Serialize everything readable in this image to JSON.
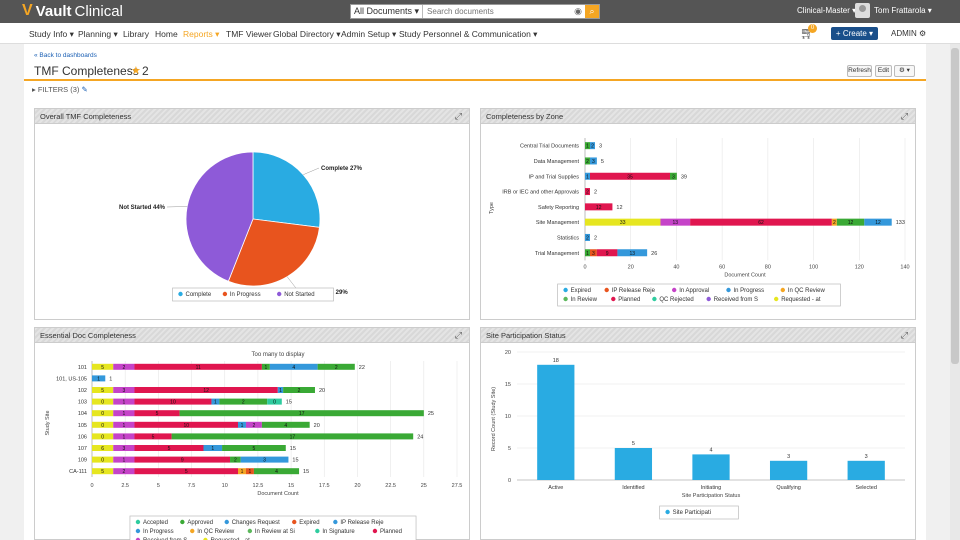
{
  "topbar": {
    "logo_text": "Vault",
    "logo_product": "Clinical",
    "search_scope": "All Documents ▾",
    "search_placeholder": "Search documents",
    "vault_name": "Clinical-Master ▾",
    "user_name": "Tom Frattarola ▾"
  },
  "nav": {
    "items": [
      {
        "label": "Study Info ▾"
      },
      {
        "label": "Planning ▾"
      },
      {
        "label": "Library"
      },
      {
        "label": "Home"
      },
      {
        "label": "Reports ▾"
      },
      {
        "label": "TMF Viewer"
      },
      {
        "label": "Global Directory ▾"
      },
      {
        "label": "Admin Setup ▾"
      },
      {
        "label": "Study Personnel & Communication ▾"
      }
    ],
    "cart_count": "0",
    "create_label": "+ Create ▾",
    "admin_label": "ADMIN ⚙"
  },
  "page": {
    "back_link": "« Back to dashboards",
    "title": "TMF Completeness 2",
    "refresh_label": "Refresh",
    "edit_label": "Edit",
    "settings_label": "⚙ ▾",
    "filters_label": "FILTERS (3)"
  },
  "colors": {
    "accent": "#f5a623",
    "brand_blue": "#1a4f8a",
    "expired": "#29abe2",
    "ip_release": "#e8541e",
    "in_approval": "#c543c8",
    "in_progress": "#3498db",
    "in_qc_review": "#f5a623",
    "in_review": "#5cb85c",
    "planned": "#e0164f",
    "qc_rejected": "#2ecc9f",
    "received": "#8e5ad8",
    "requested": "#e6e620",
    "approved": "#3aa935"
  },
  "panels": {
    "overall": "Overall TMF Completeness",
    "zone": "Completeness by Zone",
    "essential": "Essential Doc Completeness",
    "site": "Site Participation Status"
  },
  "chart_data": [
    {
      "type": "pie",
      "title": "",
      "slices": [
        {
          "name": "Complete",
          "value": 27,
          "label": "Complete 27%",
          "color": "#29abe2"
        },
        {
          "name": "In Progress",
          "value": 29,
          "label": "In Progress 29%",
          "color": "#e8541e"
        },
        {
          "name": "Not Started",
          "value": 44,
          "label": "Not Started 44%",
          "color": "#8e5ad8"
        }
      ],
      "legend": [
        "Complete",
        "In Progress",
        "Not Started"
      ],
      "legend_position": "bottom"
    },
    {
      "type": "bar",
      "orientation": "horizontal",
      "stacked": true,
      "ylabel": "Type",
      "xlabel": "Document Count",
      "xlim": [
        0,
        140
      ],
      "xticks": [
        "0",
        "20",
        "40",
        "60",
        "80",
        "100",
        "120",
        "140"
      ],
      "grid": true,
      "categories": [
        "Central Trial Documents",
        "Data Management",
        "IP and Trial Supplies",
        "IRB or IEC and other Approvals",
        "Safety Reporting",
        "Site Management",
        "Statistics",
        "Trial Management"
      ],
      "totals": [
        3,
        5,
        39,
        2,
        12,
        133,
        2,
        26
      ],
      "series": [
        {
          "name": "Expired",
          "color": "#29abe2",
          "values": [
            0,
            0,
            0,
            0,
            0,
            0,
            0,
            0
          ]
        },
        {
          "name": "IP Release Reje",
          "color": "#e8541e",
          "values": [
            0,
            0,
            0,
            0,
            0,
            0,
            0,
            3
          ]
        },
        {
          "name": "In Approval",
          "color": "#c543c8",
          "values": [
            0,
            0,
            0,
            0,
            0,
            0,
            0,
            0
          ]
        },
        {
          "name": "In Progress",
          "color": "#3498db",
          "values": [
            2,
            3,
            0,
            0,
            0,
            0,
            2,
            13
          ]
        },
        {
          "name": "In QC Review",
          "color": "#f5a623",
          "values": [
            0,
            0,
            0,
            0,
            0,
            0,
            0,
            0
          ]
        },
        {
          "name": "In Review",
          "color": "#5cb85c",
          "values": [
            0,
            0,
            0,
            0,
            0,
            0,
            0,
            0
          ]
        },
        {
          "name": "Planned",
          "color": "#e0164f",
          "values": [
            0,
            0,
            35,
            0,
            12,
            0,
            0,
            0
          ]
        },
        {
          "name": "QC Rejected",
          "color": "#2ecc9f",
          "values": [
            0,
            0,
            0,
            0,
            0,
            0,
            0,
            0
          ]
        },
        {
          "name": "Received from S",
          "color": "#8e5ad8",
          "values": [
            0,
            0,
            0,
            0,
            0,
            0,
            0,
            0
          ]
        },
        {
          "name": "Requested - at",
          "color": "#e6e620",
          "values": [
            0,
            0,
            0,
            0,
            0,
            33,
            0,
            0
          ]
        }
      ],
      "segment_labels": [
        [
          {
            "color": "#3aa935",
            "value": 1,
            "label": "1"
          },
          {
            "color": "#3498db",
            "value": 2,
            "label": "2"
          }
        ],
        [
          {
            "color": "#3aa935",
            "value": 2,
            "label": "2"
          },
          {
            "color": "#3498db",
            "value": 3,
            "label": "3"
          }
        ],
        [
          {
            "color": "#3498db",
            "value": 1,
            "label": "1"
          },
          {
            "color": "#e0164f",
            "value": 35,
            "label": "35"
          },
          {
            "color": "#3aa935",
            "value": 3,
            "label": "3"
          }
        ],
        [
          {
            "color": "#e0164f",
            "value": 2,
            "label": "2"
          }
        ],
        [
          {
            "color": "#e0164f",
            "value": 12,
            "label": "12"
          }
        ],
        [
          {
            "color": "#e6e620",
            "value": 33,
            "label": "33"
          },
          {
            "color": "#c543c8",
            "value": 13,
            "label": "13"
          },
          {
            "color": "#e0164f",
            "value": 62,
            "label": "62"
          },
          {
            "color": "#f5a623",
            "value": 2,
            "label": "2"
          },
          {
            "color": "#3aa935",
            "value": 12,
            "label": "12"
          },
          {
            "color": "#3498db",
            "value": 12,
            "label": "12"
          }
        ],
        [
          {
            "color": "#3498db",
            "value": 2,
            "label": "2"
          }
        ],
        [
          {
            "color": "#3aa935",
            "value": 1,
            "label": "1"
          },
          {
            "color": "#e8541e",
            "value": 3,
            "label": "3"
          },
          {
            "color": "#e0164f",
            "value": 9,
            "label": "9"
          },
          {
            "color": "#3498db",
            "value": 13,
            "label": "13"
          }
        ]
      ],
      "legend_position": "bottom"
    },
    {
      "type": "bar",
      "orientation": "horizontal",
      "stacked": true,
      "annotation": "Too many to display",
      "ylabel": "Study Site",
      "xlabel": "Document Count",
      "xlim": [
        0,
        27.5
      ],
      "xticks": [
        "0",
        "2.5",
        "5",
        "7.5",
        "10",
        "12.5",
        "15",
        "17.5",
        "20",
        "22.5",
        "25",
        "27.5"
      ],
      "grid": true,
      "categories": [
        "101",
        "101, US-105",
        "102",
        "103",
        "104",
        "105",
        "106",
        "107",
        "109",
        "CA-111"
      ],
      "totals": [
        22,
        1,
        20,
        15,
        25,
        20,
        24,
        15,
        15,
        15
      ],
      "segments": [
        [
          {
            "c": "#e6e620",
            "v": 1.6,
            "l": "5"
          },
          {
            "c": "#c543c8",
            "v": 1.6,
            "l": "2"
          },
          {
            "c": "#e0164f",
            "v": 9.6,
            "l": "11"
          },
          {
            "c": "#3aa935",
            "v": 0.6,
            "l": "1"
          },
          {
            "c": "#3498db",
            "v": 3.6,
            "l": "4"
          },
          {
            "c": "#3aa935",
            "v": 2.8,
            "l": "2"
          }
        ],
        [
          {
            "c": "#3498db",
            "v": 1,
            "l": "1"
          }
        ],
        [
          {
            "c": "#e6e620",
            "v": 1.6,
            "l": "5"
          },
          {
            "c": "#c543c8",
            "v": 1.6,
            "l": "3"
          },
          {
            "c": "#e0164f",
            "v": 10.8,
            "l": "12"
          },
          {
            "c": "#3498db",
            "v": 0.4,
            "l": "1"
          },
          {
            "c": "#3aa935",
            "v": 2.4,
            "l": "2"
          }
        ],
        [
          {
            "c": "#e6e620",
            "v": 1.6,
            "l": "0"
          },
          {
            "c": "#c543c8",
            "v": 1.6,
            "l": "1"
          },
          {
            "c": "#e0164f",
            "v": 5.8,
            "l": "10"
          },
          {
            "c": "#3498db",
            "v": 0.6,
            "l": "1"
          },
          {
            "c": "#3aa935",
            "v": 3.6,
            "l": "2"
          },
          {
            "c": "#2ecc9f",
            "v": 1.1,
            "l": "0"
          }
        ],
        [
          {
            "c": "#e6e620",
            "v": 1.6,
            "l": "0"
          },
          {
            "c": "#c543c8",
            "v": 1.6,
            "l": "1"
          },
          {
            "c": "#e0164f",
            "v": 3.4,
            "l": "5"
          },
          {
            "c": "#3aa935",
            "v": 18.4,
            "l": "17"
          }
        ],
        [
          {
            "c": "#e6e620",
            "v": 1.6,
            "l": "0"
          },
          {
            "c": "#c543c8",
            "v": 1.6,
            "l": "1"
          },
          {
            "c": "#e0164f",
            "v": 7.8,
            "l": "10"
          },
          {
            "c": "#3498db",
            "v": 0.6,
            "l": "1"
          },
          {
            "c": "#c543c8",
            "v": 1.2,
            "l": "2"
          },
          {
            "c": "#3aa935",
            "v": 3.6,
            "l": "4"
          }
        ],
        [
          {
            "c": "#e6e620",
            "v": 1.6,
            "l": "0"
          },
          {
            "c": "#c543c8",
            "v": 1.6,
            "l": "1"
          },
          {
            "c": "#e0164f",
            "v": 2.8,
            "l": "5"
          },
          {
            "c": "#3aa935",
            "v": 18.2,
            "l": "17"
          }
        ],
        [
          {
            "c": "#e6e620",
            "v": 1.6,
            "l": "6"
          },
          {
            "c": "#c543c8",
            "v": 1.6,
            "l": "3"
          },
          {
            "c": "#e0164f",
            "v": 5.2,
            "l": "5"
          },
          {
            "c": "#3498db",
            "v": 1.4,
            "l": "1"
          },
          {
            "c": "#3aa935",
            "v": 4.8,
            "l": "5"
          }
        ],
        [
          {
            "c": "#e6e620",
            "v": 1.6,
            "l": "0"
          },
          {
            "c": "#c543c8",
            "v": 1.6,
            "l": "1"
          },
          {
            "c": "#e0164f",
            "v": 7.2,
            "l": "9"
          },
          {
            "c": "#3aa935",
            "v": 0.8,
            "l": "2"
          },
          {
            "c": "#3498db",
            "v": 3.6,
            "l": "3"
          }
        ],
        [
          {
            "c": "#e6e620",
            "v": 1.6,
            "l": "5"
          },
          {
            "c": "#c543c8",
            "v": 1.6,
            "l": "2"
          },
          {
            "c": "#e0164f",
            "v": 7.8,
            "l": "5"
          },
          {
            "c": "#f5a623",
            "v": 0.6,
            "l": "1"
          },
          {
            "c": "#e8541e",
            "v": 0.6,
            "l": "1"
          },
          {
            "c": "#3aa935",
            "v": 3.4,
            "l": "4"
          }
        ]
      ],
      "legend": [
        {
          "name": "Accepted",
          "color": "#2ecc9f"
        },
        {
          "name": "Approved",
          "color": "#3aa935"
        },
        {
          "name": "Changes Request",
          "color": "#3498db"
        },
        {
          "name": "Expired",
          "color": "#e8541e"
        },
        {
          "name": "IP Release Reje",
          "color": "#3498db"
        },
        {
          "name": "In Progress",
          "color": "#3498db"
        },
        {
          "name": "In QC Review",
          "color": "#f5a623"
        },
        {
          "name": "In Review at Si",
          "color": "#5cb85c"
        },
        {
          "name": "In Signature",
          "color": "#2ecc9f"
        },
        {
          "name": "Planned",
          "color": "#e0164f"
        },
        {
          "name": "Received from S",
          "color": "#c543c8"
        },
        {
          "name": "Requested - at",
          "color": "#e6e620"
        }
      ],
      "legend_position": "bottom"
    },
    {
      "type": "bar",
      "orientation": "vertical",
      "ylabel": "Record Count (Study Site)",
      "xlabel": "Site Participation Status",
      "ylim": [
        0,
        20
      ],
      "yticks": [
        "0",
        "5",
        "10",
        "15",
        "20"
      ],
      "grid": true,
      "categories": [
        "Active",
        "Identified",
        "Initiating",
        "Qualifying",
        "Selected"
      ],
      "values": [
        18,
        5,
        4,
        3,
        3
      ],
      "value_labels": [
        "18",
        "5",
        "4",
        "3",
        "3"
      ],
      "series_name": "Site Participati",
      "color": "#29abe2",
      "legend_position": "bottom"
    }
  ]
}
